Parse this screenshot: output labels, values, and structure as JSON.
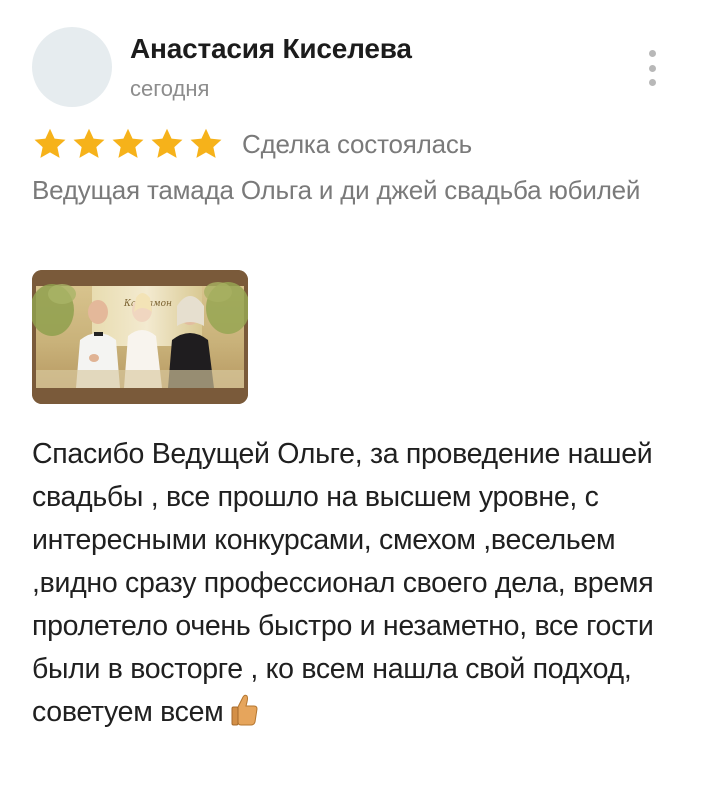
{
  "review": {
    "author_name": "Анастасия Киселева",
    "date": "сегодня",
    "rating": 5,
    "rating_max": 5,
    "star_color": "#f6b21a",
    "deal_status": "Сделка состоялась",
    "service_title": "Ведущая тамада Ольга и ди джей свадьба юбилей",
    "text": "Спасибо Ведущей Ольге, за проведение нашей свадьбы , все прошло на высшем уровне, с интересными конкурсами, смехом ,весельем ,видно сразу профессионал своего дела, время пролетело очень быстро и незаметно, все гости были в восторге , ко всем нашла свой подход, советуем всем",
    "photo_sign_text": "Кардамон",
    "emoji_icon": "thumbs-up-icon",
    "menu_icon": "more-vertical-icon"
  }
}
